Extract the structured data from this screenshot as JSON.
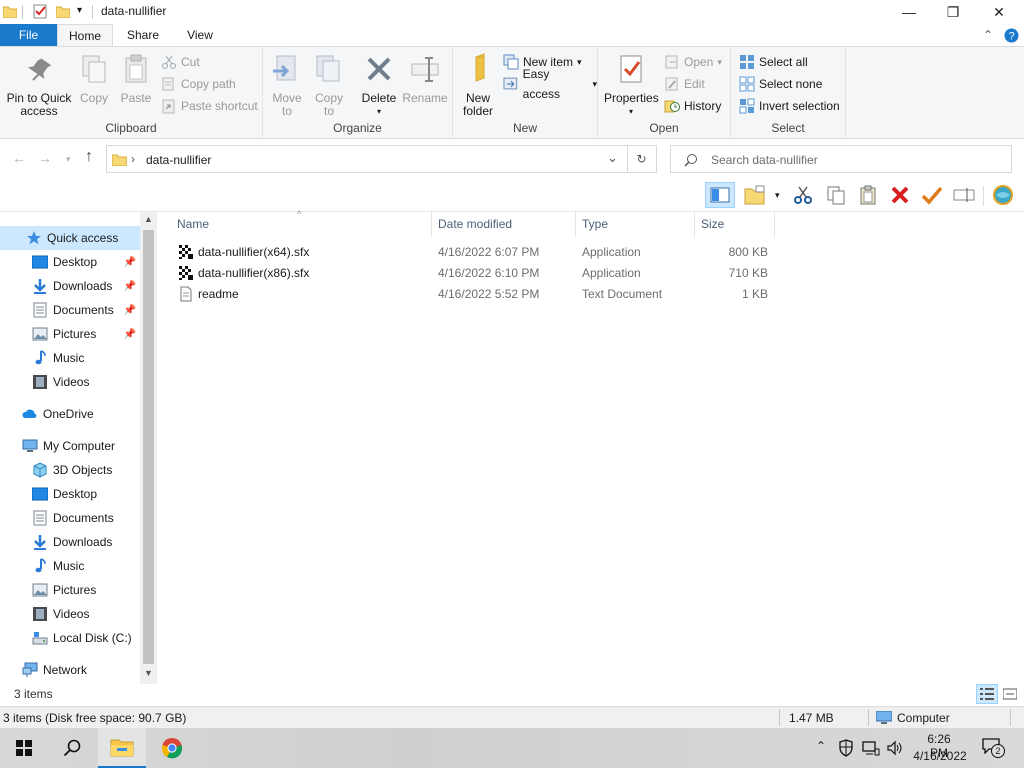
{
  "window": {
    "title": "data-nullifier",
    "minimize_glyph": "—",
    "maximize_glyph": "❐",
    "close_glyph": "✕"
  },
  "ribbon_tabs": [
    "File",
    "Home",
    "Share",
    "View"
  ],
  "ribbon": {
    "clipboard": {
      "label": "Clipboard",
      "pin_label_1": "Pin to Quick",
      "pin_label_2": "access",
      "copy": "Copy",
      "paste": "Paste",
      "cut": "Cut",
      "copy_path": "Copy path",
      "paste_shortcut": "Paste shortcut"
    },
    "organize": {
      "label": "Organize",
      "move_to_1": "Move",
      "move_to_2": "to",
      "copy_to_1": "Copy",
      "copy_to_2": "to",
      "delete": "Delete",
      "rename": "Rename"
    },
    "new": {
      "label": "New",
      "new_folder_1": "New",
      "new_folder_2": "folder",
      "new_item": "New item",
      "easy_access": "Easy access"
    },
    "open": {
      "label": "Open",
      "properties": "Properties",
      "open": "Open",
      "edit": "Edit",
      "history": "History"
    },
    "select": {
      "label": "Select",
      "select_all": "Select all",
      "select_none": "Select none",
      "invert_selection": "Invert selection"
    }
  },
  "address": {
    "path_folder": "data-nullifier",
    "search_placeholder": "Search data-nullifier"
  },
  "nav": {
    "quick_access": "Quick access",
    "qa_items": [
      "Desktop",
      "Downloads",
      "Documents",
      "Pictures",
      "Music",
      "Videos"
    ],
    "onedrive": "OneDrive",
    "my_computer": "My Computer",
    "pc_items": [
      "3D Objects",
      "Desktop",
      "Documents",
      "Downloads",
      "Music",
      "Pictures",
      "Videos",
      "Local Disk (C:)"
    ],
    "network": "Network"
  },
  "columns": [
    "Name",
    "Date modified",
    "Type",
    "Size"
  ],
  "files": [
    {
      "name": "data-nullifier(x64).sfx",
      "date": "4/16/2022 6:07 PM",
      "type": "Application",
      "size": "800 KB",
      "icon": "sfx-application-icon"
    },
    {
      "name": "data-nullifier(x86).sfx",
      "date": "4/16/2022 6:10 PM",
      "type": "Application",
      "size": "710 KB",
      "icon": "sfx-application-icon"
    },
    {
      "name": "readme",
      "date": "4/16/2022 5:52 PM",
      "type": "Text Document",
      "size": "1 KB",
      "icon": "text-document-icon"
    }
  ],
  "status": {
    "item_count": "3 items",
    "details": "3 items (Disk free space: 90.7 GB)",
    "size": "1.47 MB",
    "location": "Computer"
  },
  "taskbar": {
    "time": "6:26 PM",
    "date": "4/16/2022",
    "notification_count": "2"
  },
  "colors": {
    "accent": "#1979ca",
    "selected_bg": "#cce8ff",
    "folder_yellow": "#f8d775",
    "delete_red": "#d61f1f",
    "check_orange": "#e07b1a"
  }
}
